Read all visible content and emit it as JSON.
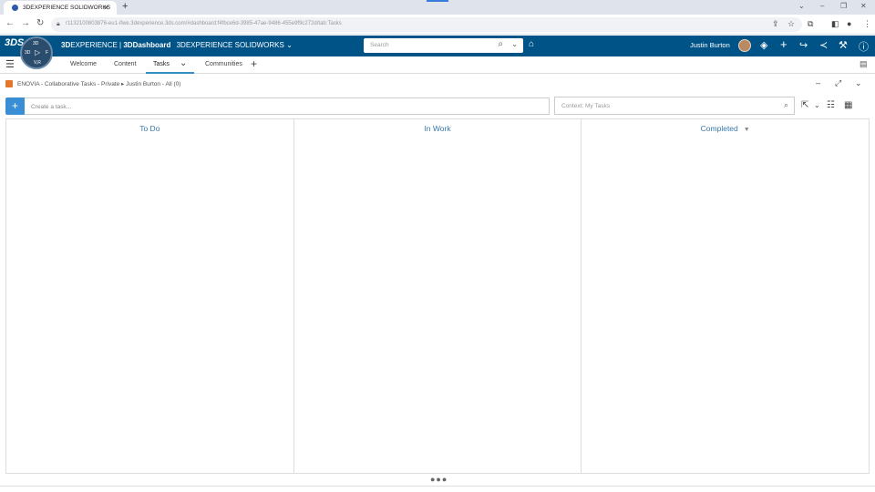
{
  "browser": {
    "tab_title": "3DEXPERIENCE SOLIDWORKS",
    "url": "r1132100803876-eu1-ifwe.3dexperience.3ds.com/#dashboard:f4fbce6d-3985-47ae-9486-455e9f9c272d/tab:Tasks"
  },
  "header": {
    "brand_prefix": "3D",
    "brand_experience": "EXPERIENCE",
    "brand_sep": " | ",
    "brand_dashboard": "3DDashboard",
    "app_name": "3DEXPERIENCE SOLIDWORKS",
    "search_placeholder": "Search",
    "user_name": "Justin Burton",
    "compass": {
      "top": "3D",
      "left": "3D",
      "right": "F",
      "bottom": "V,R"
    }
  },
  "tabs": [
    {
      "label": "Welcome"
    },
    {
      "label": "Content"
    },
    {
      "label": "Tasks"
    },
    {
      "label": "Communities"
    }
  ],
  "widget": {
    "title": "ENOVIA - Collaborative Tasks - Private ▸ Justin Burton - All (0)",
    "create_placeholder": "Create a task...",
    "context_placeholder": "Context: My Tasks",
    "columns": [
      {
        "title": "To Do"
      },
      {
        "title": "In Work"
      },
      {
        "title": "Completed"
      }
    ]
  },
  "colors": {
    "topbar": "#005386",
    "accent": "#368ec4",
    "column_title": "#3778ab"
  }
}
